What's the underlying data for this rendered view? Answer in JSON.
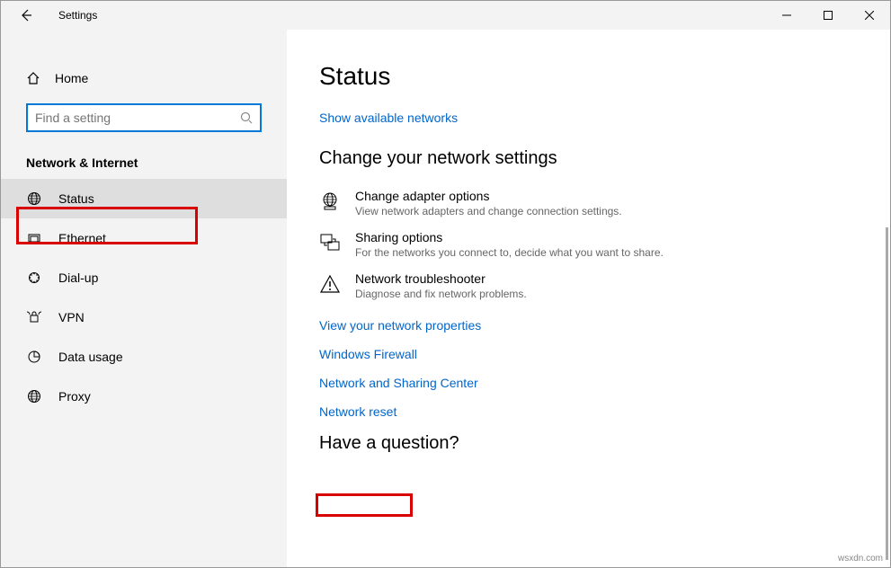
{
  "titlebar": {
    "title": "Settings"
  },
  "sidebar": {
    "home": "Home",
    "search_placeholder": "Find a setting",
    "section": "Network & Internet",
    "items": [
      {
        "label": "Status",
        "icon": "globe",
        "active": true
      },
      {
        "label": "Ethernet",
        "icon": "ethernet"
      },
      {
        "label": "Dial-up",
        "icon": "dialup"
      },
      {
        "label": "VPN",
        "icon": "vpn"
      },
      {
        "label": "Data usage",
        "icon": "data"
      },
      {
        "label": "Proxy",
        "icon": "globe"
      }
    ]
  },
  "main": {
    "heading": "Status",
    "show_networks": "Show available networks",
    "change_heading": "Change your network settings",
    "options": [
      {
        "title": "Change adapter options",
        "desc": "View network adapters and change connection settings."
      },
      {
        "title": "Sharing options",
        "desc": "For the networks you connect to, decide what you want to share."
      },
      {
        "title": "Network troubleshooter",
        "desc": "Diagnose and fix network problems."
      }
    ],
    "links": [
      "View your network properties",
      "Windows Firewall",
      "Network and Sharing Center",
      "Network reset"
    ],
    "question": "Have a question?"
  },
  "watermark": "wsxdn.com"
}
